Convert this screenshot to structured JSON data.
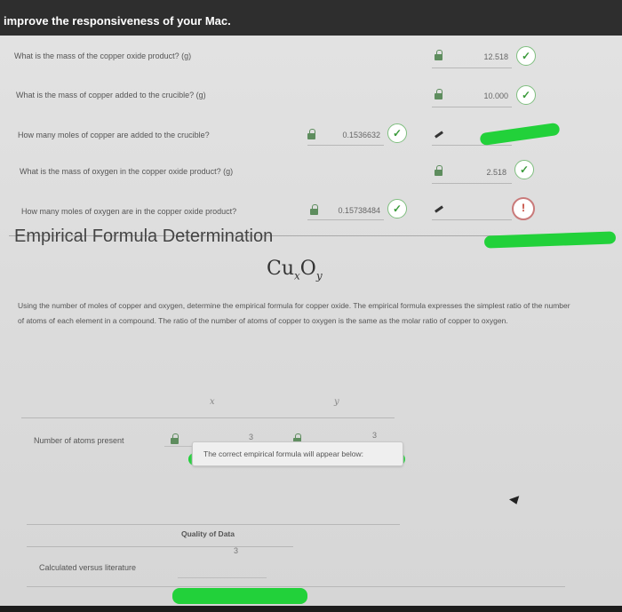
{
  "banner": {
    "text": "improve the responsiveness of your Mac."
  },
  "questions": [
    {
      "label": "What is the mass of the copper oxide product? (g)",
      "value": "12.518"
    },
    {
      "label": "What is the mass of copper added to the crucible? (g)",
      "value": "10.000"
    },
    {
      "label": "How many moles of copper are added to the crucible?",
      "value": "0.1536632"
    },
    {
      "label": "What is the mass of oxygen in the copper oxide product? (g)",
      "value": "2.518"
    },
    {
      "label": "How many moles of oxygen are in the copper oxide product?",
      "value": "0.15738484"
    }
  ],
  "section": {
    "title": "Empirical Formula Determination",
    "formula": {
      "base1": "Cu",
      "sub1": "x",
      "base2": "O",
      "sub2": "y"
    },
    "instructions": "Using the number of moles of copper and oxygen, determine the empirical formula for copper oxide. The empirical formula expresses the simplest ratio of the number of atoms of each element in a compound. The ratio of the number of atoms of copper to oxygen is the same as the molar ratio of copper to oxygen."
  },
  "table": {
    "col_x": "x",
    "col_y": "y",
    "row_label": "Number of atoms present",
    "x_value": "3",
    "y_value": "3"
  },
  "result_box": {
    "text": "The correct empirical formula will appear below:"
  },
  "quality": {
    "heading": "Quality of Data",
    "row_label": "Calculated versus literature",
    "value": "3"
  },
  "colors": {
    "highlight": "#22d13a",
    "check": "#3a9a3a",
    "lock": "#5e8d5e"
  }
}
